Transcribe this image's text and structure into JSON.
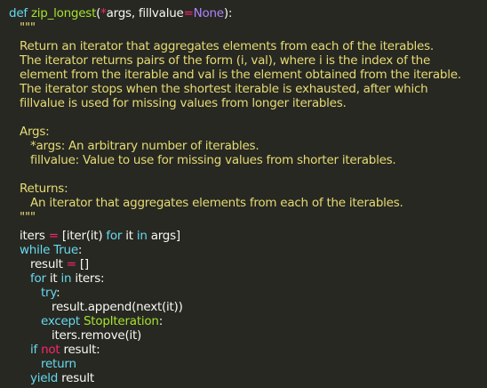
{
  "code": {
    "def_kw": "def",
    "func_name": "zip_longest",
    "sig_open": "(",
    "star": "*",
    "sig_args": "args, fillvalue",
    "sig_eq": "=",
    "none_kw": "None",
    "sig_close": "):",
    "doc_open": "\"\"\"",
    "doc_lines": [
      "Return an iterator that aggregates elements from each of the iterables.",
      "The iterator returns pairs of the form (i, val), where i is the index of the",
      "element from the iterable and val is the element obtained from the iterable.",
      "The iterator stops when the shortest iterable is exhausted, after which",
      "fillvalue is used for missing values from longer iterables."
    ],
    "args_header": "Args:",
    "arg_lines": [
      "*args: An arbitrary number of iterables.",
      "fillvalue: Value to use for missing values from shorter iterables."
    ],
    "returns_header": "Returns:",
    "returns_line": "An iterator that aggregates elements from each of the iterables.",
    "doc_close": "\"\"\"",
    "iters_var": "iters",
    "eq": "=",
    "iters_expr_a": "[iter(it)",
    "for_kw": "for",
    "it_var": "it",
    "in_kw": "in",
    "iters_expr_b": "args]",
    "while_kw": "while",
    "true_kw": "True",
    "colon": ":",
    "result_var": "result",
    "empty_list": "[]",
    "iters_name": "iters",
    "try_kw": "try",
    "append_stmt": "result.append(next(it))",
    "except_kw": "except",
    "stop_iteration": "StopIteration",
    "remove_stmt": "iters.remove(it)",
    "if_kw": "if",
    "not_kw": "not",
    "return_kw": "return",
    "yield_kw": "yield"
  },
  "colors": {
    "background": "#272822",
    "keyword": "#66d9ef",
    "function": "#a6e22e",
    "operator": "#f92672",
    "constant": "#ae81ff",
    "string": "#e6db74",
    "text": "#f8f8f2"
  }
}
